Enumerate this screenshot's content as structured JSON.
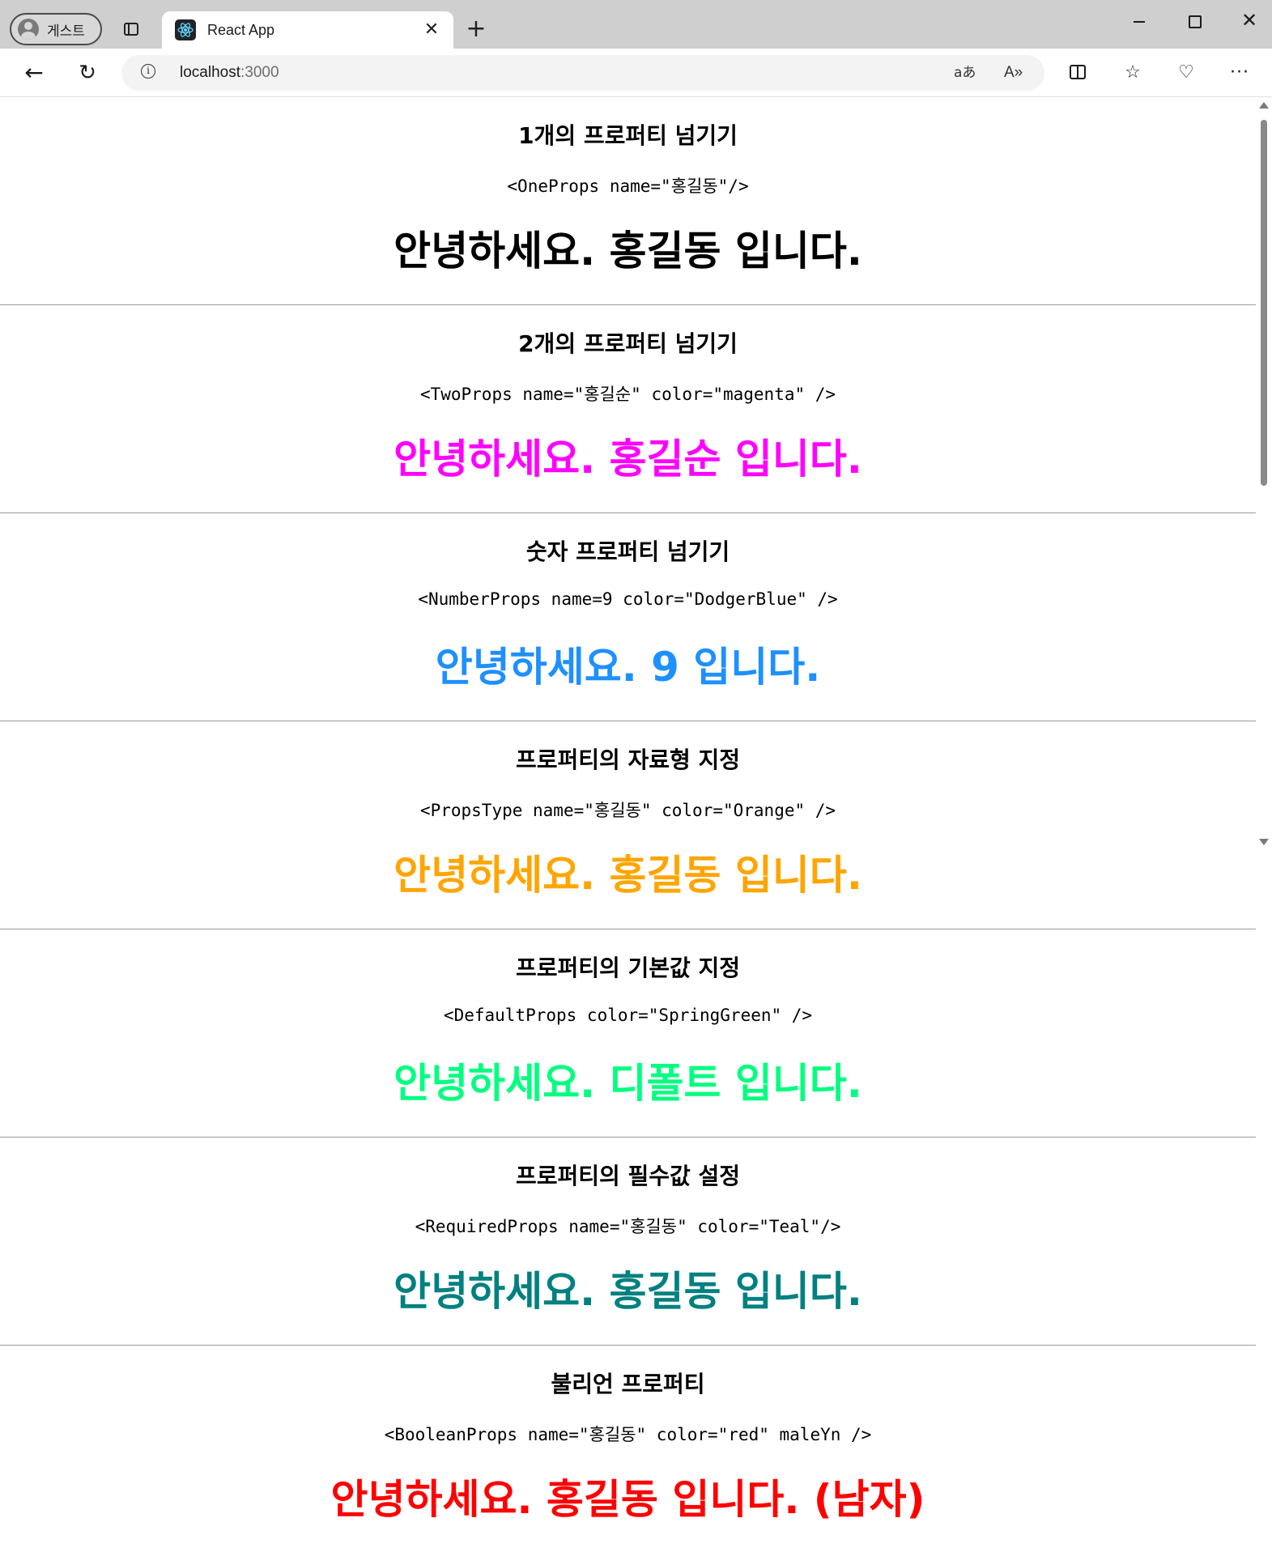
{
  "browser": {
    "profile_label": "게스트",
    "tab_title": "React App",
    "url_host": "localhost",
    "url_port": ":3000",
    "translate_glyph": "aあ",
    "read_aloud_glyph": "A»",
    "more_glyph": "···"
  },
  "sections": [
    {
      "title": "1개의 프로퍼티 넘기기",
      "code": "<OneProps name=\"홍길동\"/>",
      "greeting": "안녕하세요. 홍길동 입니다.",
      "color": "#000000"
    },
    {
      "title": "2개의 프로퍼티 넘기기",
      "code": "<TwoProps name=\"홍길순\" color=\"magenta\" />",
      "greeting": "안녕하세요. 홍길순 입니다.",
      "color": "#ff00ff"
    },
    {
      "title": "숫자 프로퍼티 넘기기",
      "code": "<NumberProps name=9 color=\"DodgerBlue\" />",
      "greeting": "안녕하세요. 9 입니다.",
      "color": "#1e90ff"
    },
    {
      "title": "프로퍼티의 자료형 지정",
      "code": "<PropsType name=\"홍길동\" color=\"Orange\" />",
      "greeting": "안녕하세요. 홍길동 입니다.",
      "color": "#ffa500"
    },
    {
      "title": "프로퍼티의 기본값 지정",
      "code": "<DefaultProps color=\"SpringGreen\" />",
      "greeting": "안녕하세요. 디폴트 입니다.",
      "color": "#00ff7f"
    },
    {
      "title": "프로퍼티의 필수값 설정",
      "code": "<RequiredProps name=\"홍길동\" color=\"Teal\"/>",
      "greeting": "안녕하세요. 홍길동 입니다.",
      "color": "#008080"
    },
    {
      "title": "불리언 프로퍼티",
      "code": "<BooleanProps name=\"홍길동\" color=\"red\" maleYn />",
      "greeting": "안녕하세요. 홍길동 입니다. (남자)",
      "color": "#ff0000"
    }
  ]
}
